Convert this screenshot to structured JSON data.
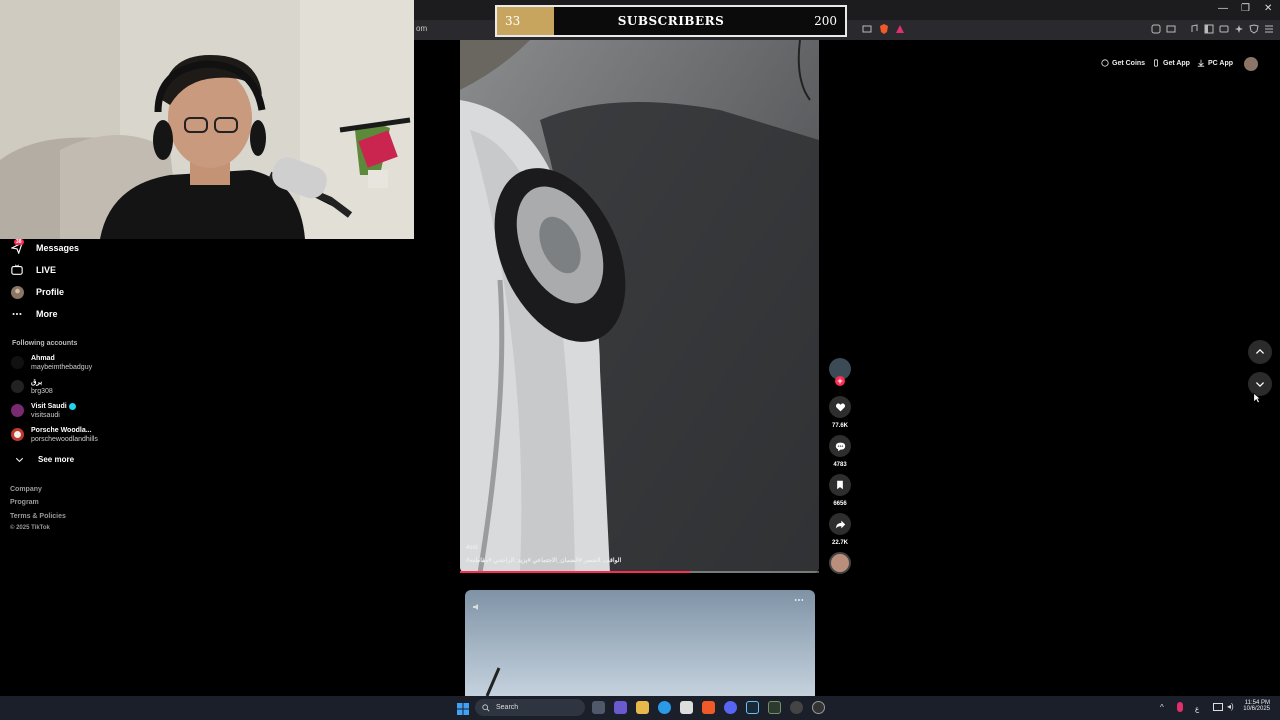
{
  "browser": {
    "url_fragment": "om",
    "window_controls": [
      "—",
      "❐",
      "✕"
    ]
  },
  "subscriber_goal": {
    "current": "33",
    "label": "SUBSCRIBERS",
    "goal": "200",
    "progress_fraction": 0.165,
    "fill_color": "#c8a55e"
  },
  "sidebar": {
    "messages_badge": "38",
    "items": [
      {
        "label": "Messages",
        "icon": "paper-plane-icon"
      },
      {
        "label": "LIVE",
        "icon": "live-tv-icon"
      },
      {
        "label": "Profile",
        "icon": "avatar-icon"
      },
      {
        "label": "More",
        "icon": "more-dots-icon"
      }
    ],
    "following_heading": "Following accounts",
    "accounts": [
      {
        "name": "Ahmad",
        "handle": "maybeimthebadguy"
      },
      {
        "name": "برق",
        "handle": "brg308"
      },
      {
        "name": "Visit Saudi",
        "handle": "visitsaudi",
        "verified": true
      },
      {
        "name": "Porsche Woodla...",
        "handle": "porschewoodlandhills"
      }
    ],
    "see_more": "See more",
    "footer": [
      "Company",
      "Program",
      "Terms & Policies",
      "© 2025 TikTok"
    ]
  },
  "top_right": {
    "get_coins": "Get Coins",
    "get_app": "Get App",
    "pc_app": "PC App"
  },
  "video": {
    "tag": "#cxi",
    "description": "#الواقف_العنصر  #الضمان_الاجتماعي  #يزيد_الراجحي  #مقاطعه",
    "progress_fraction": 0.64
  },
  "actions": {
    "likes": "77.6K",
    "comments": "4783",
    "saves": "6656",
    "shares": "22.7K"
  },
  "taskbar": {
    "search_placeholder": "Search",
    "time": "11:54 PM",
    "date": "10/6/2025",
    "lang": "ع"
  },
  "colors": {
    "accent": "#fe2c55",
    "background": "#000000"
  }
}
